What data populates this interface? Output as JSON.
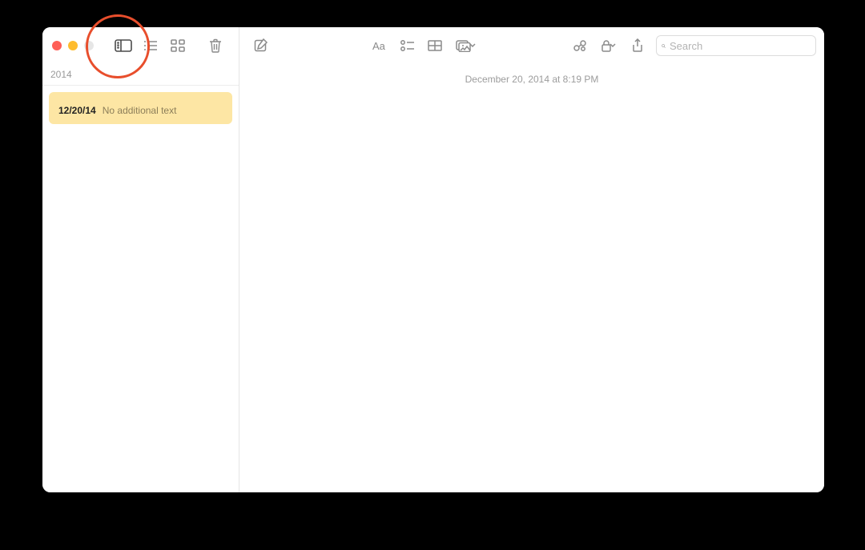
{
  "sidebar": {
    "group_label": "2014",
    "notes": [
      {
        "title_glyph": "",
        "date": "12/20/14",
        "preview": "No additional text"
      }
    ]
  },
  "editor": {
    "timestamp": "December 20, 2014 at 8:19 PM",
    "content_glyph": ""
  },
  "toolbar": {
    "search_placeholder": "Search"
  }
}
